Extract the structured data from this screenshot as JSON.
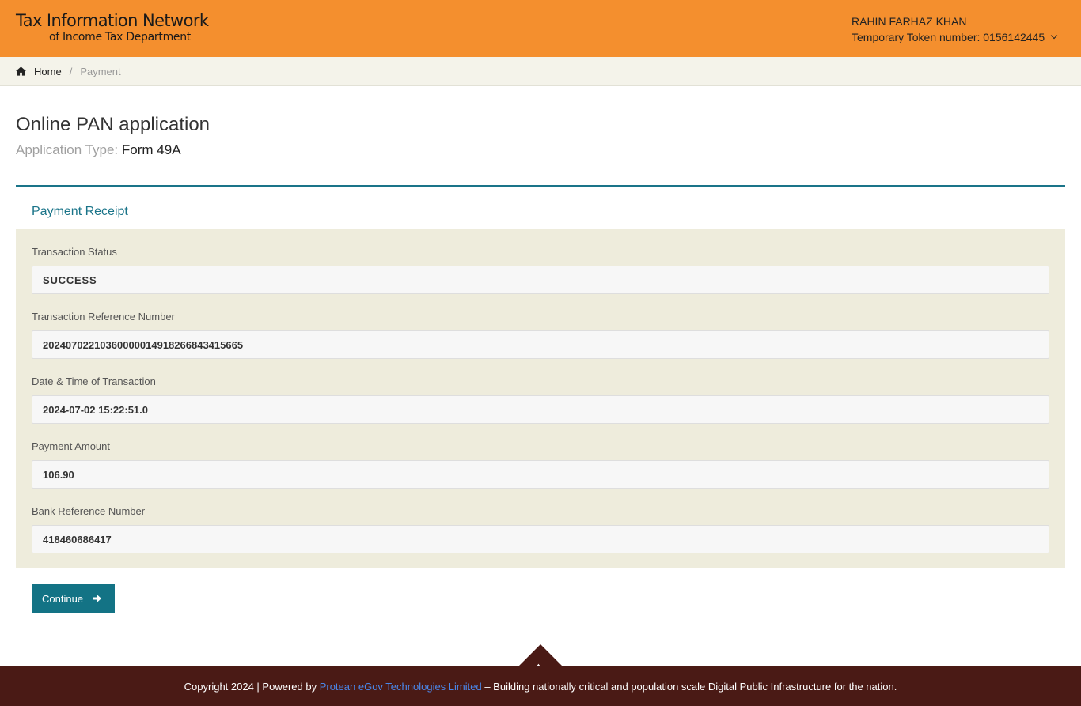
{
  "header": {
    "logo_line1": "Tax Information Network",
    "logo_line2": "of Income Tax Department",
    "user_name": "RAHIN FARHAZ KHAN",
    "token_label": "Temporary Token number: 0156142445"
  },
  "breadcrumb": {
    "home": "Home",
    "separator": "/",
    "current": "Payment"
  },
  "page": {
    "title": "Online PAN application",
    "app_type_label": "Application Type:",
    "app_type_value": "Form 49A"
  },
  "receipt": {
    "section_title": "Payment Receipt",
    "fields": [
      {
        "label": "Transaction Status",
        "value": "SUCCESS"
      },
      {
        "label": "Transaction Reference Number",
        "value": "20240702210360000014918266843415665"
      },
      {
        "label": "Date & Time of Transaction",
        "value": "2024-07-02 15:22:51.0"
      },
      {
        "label": "Payment Amount",
        "value": "106.90"
      },
      {
        "label": "Bank Reference Number",
        "value": "418460686417"
      }
    ]
  },
  "actions": {
    "continue_label": "Continue"
  },
  "footer": {
    "prefix": "Copyright 2024 | Powered by",
    "link_text": "Protean eGov Technologies Limited",
    "suffix": "– Building nationally critical and population scale Digital Public Infrastructure for the nation."
  },
  "colors": {
    "header_bg": "#f48f2e",
    "accent": "#137385",
    "panel_bg": "#eeecdc",
    "footer_bg": "#4a1a15"
  },
  "icons": {
    "home": "home-icon",
    "continue": "arrow-right-icon",
    "user_menu": "chevron-down-icon",
    "scroll_top": "arrow-up-icon"
  }
}
